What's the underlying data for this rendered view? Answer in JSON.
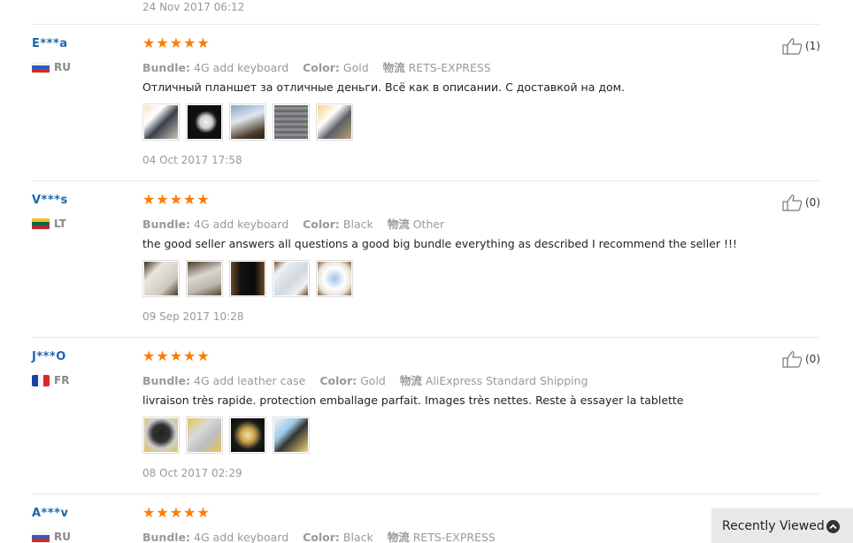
{
  "top_date": "24 Nov 2017 06:12",
  "reviews": [
    {
      "user": "E***a",
      "country": "RU",
      "stars": "★★★★★",
      "bundle_label": "Bundle:",
      "bundle_value": "4G add keyboard",
      "color_label": "Color:",
      "color_value": "Gold",
      "shipping_label": "物流",
      "shipping_value": "RETS-EXPRESS",
      "feedback": "Отличный планшет за отличные деньги. Всё как в описании. С доставкой на дом.",
      "photo_count": 5,
      "date": "04 Oct 2017 17:58",
      "helpful": "(1)"
    },
    {
      "user": "V***s",
      "country": "LT",
      "stars": "★★★★★",
      "bundle_label": "Bundle:",
      "bundle_value": "4G add keyboard",
      "color_label": "Color:",
      "color_value": "Black",
      "shipping_label": "物流",
      "shipping_value": "Other",
      "feedback": "the good seller answers all questions a good big bundle everything as described I recommend the seller !!!",
      "photo_count": 5,
      "date": "09 Sep 2017 10:28",
      "helpful": "(0)"
    },
    {
      "user": "J***O",
      "country": "FR",
      "stars": "★★★★★",
      "bundle_label": "Bundle:",
      "bundle_value": "4G add leather case",
      "color_label": "Color:",
      "color_value": "Gold",
      "shipping_label": "物流",
      "shipping_value": "AliExpress Standard Shipping",
      "feedback": "livraison très rapide. protection emballage parfait. Images très nettes. Reste à essayer la tablette",
      "photo_count": 4,
      "date": "08 Oct 2017 02:29",
      "helpful": "(0)"
    },
    {
      "user": "A***v",
      "country": "RU",
      "stars": "★★★★★",
      "bundle_label": "Bundle:",
      "bundle_value": "4G add keyboard",
      "color_label": "Color:",
      "color_value": "Black",
      "shipping_label": "物流",
      "shipping_value": "RETS-EXPRESS"
    }
  ],
  "recently_viewed": {
    "label": "Recently Viewed",
    "icon": "chevron-up-circle-icon"
  },
  "colors": {
    "star": "#ff7a00",
    "username": "#1d66b2",
    "muted": "#999999",
    "panel": "#e8e8e8"
  }
}
